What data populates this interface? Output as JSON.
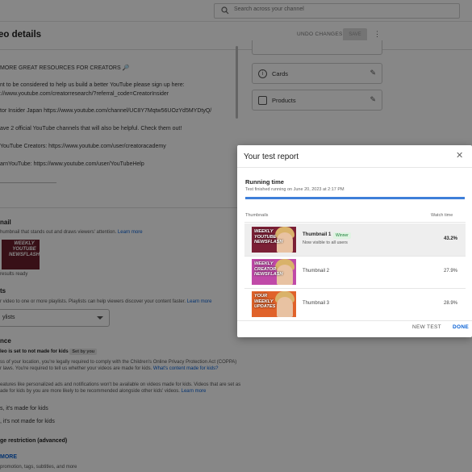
{
  "search": {
    "placeholder": "Search across your channel"
  },
  "header": {
    "title": "eo details",
    "undo_label": "UNDO CHANGES",
    "save_label": "SAVE"
  },
  "description_lines": [
    "MORE GREAT RESOURCES FOR CREATORS 🔎",
    "nt to be considered to help us build a better YouTube please sign up here:",
    "://www.youtube.com/creatorresearch/?referral_code=CreatorInsider",
    "tor Insider Japan https://www.youtube.com/channel/UC8Y7Mqtw56UOzYd5MYDtyQ/",
    "ave 2 official YouTube channels that will also be helpful. Check them out!",
    "YouTube Creators: https://www.youtube.com/user/creatoracademy",
    "arnYouTube: https://www.youtube.com/user/YouTubeHelp"
  ],
  "side_cards": [
    {
      "label": "Cards",
      "icon": "info-icon"
    },
    {
      "label": "Products",
      "icon": "shopping-bag-icon"
    }
  ],
  "thumbnail_section": {
    "title": "nail",
    "text": "humbnail that stands out and draws viewers' attention.",
    "link": "Learn more",
    "status": "results ready",
    "thumb_text": "WEEKLY YOUTUBE NEWSFLASH"
  },
  "playlists_section": {
    "title": "ts",
    "text": "r video to one or more playlists. Playlists can help viewers discover your content faster.",
    "link": "Learn more",
    "select_value": "ylists"
  },
  "audience_section": {
    "title": "nce",
    "status": "leo is set to not made for kids",
    "chip": "Set by you",
    "line1": "ss of your location, you're legally required to comply with the Children's Online Privacy Protection Act (COPPA)",
    "line2": "r laws. You're required to tell us whether your videos are made for kids.",
    "line2_link": "What's content made for kids?",
    "line3": "eatures like personalized ads and notifications won't be available on videos made for kids. Videos that are set as",
    "line4": "ade for kids by you are more likely to be recommended alongside other kids' videos.",
    "line4_link": "Learn more",
    "option_yes": "s, it's made for kids",
    "option_no": ", it's not made for kids",
    "age_title": "ge restriction (advanced)",
    "show_more": "MORE",
    "more_text": "promotion, tags, subtitles, and more"
  },
  "dialog": {
    "title": "Your test report",
    "close_icon": "close-icon",
    "running_time_title": "Running time",
    "running_time_sub": "Test finished running on June 20, 2023 at 2:17 PM",
    "progress": 1.0,
    "col_thumbnails": "Thumbnails",
    "col_watch_time": "Watch time",
    "rows": [
      {
        "name": "Thumbnail 1",
        "badge": "Winner",
        "status": "Now visible to all users",
        "pct": "43.2%",
        "thumb_text": "WEEKLY YOUTUBE NEWSFLASH",
        "bg": "#7b1f35"
      },
      {
        "name": "Thumbnail 2",
        "badge": "",
        "status": "",
        "pct": "27.9%",
        "thumb_text": "WEEKLY CREATOR NEWSFLASH",
        "bg": "#c04aa8"
      },
      {
        "name": "Thumbnail 3",
        "badge": "",
        "status": "",
        "pct": "28.9%",
        "thumb_text": "YOUR WEEKLY UPDATES",
        "bg": "#e0622a"
      }
    ],
    "new_test_label": "NEW TEST",
    "done_label": "DONE"
  },
  "colors": {
    "accent": "#065fd4",
    "winner_green": "#1a7f37",
    "progress": "#3e7fd9"
  }
}
